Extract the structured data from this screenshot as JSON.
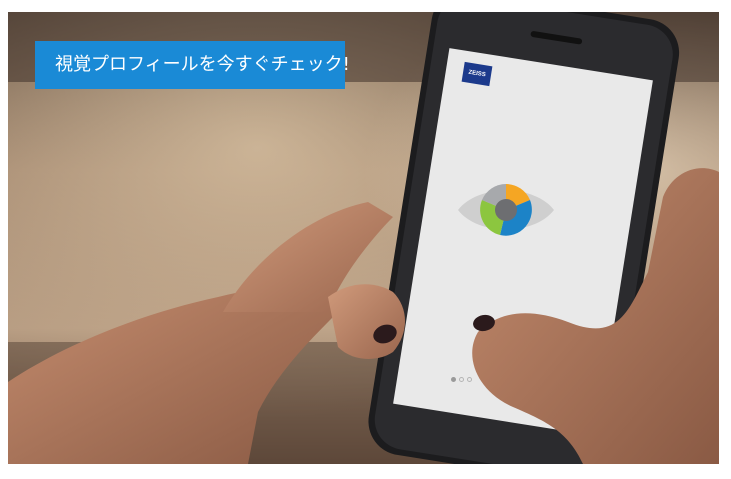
{
  "banner": {
    "text": "視覚プロフィールを今すぐチェック!",
    "color": "#1a8ad6"
  },
  "phone_screen": {
    "logo_text": "ZEISS",
    "logo_color": "#1c3a8c",
    "icon": "eye-icon",
    "pagination": {
      "pages": 3,
      "active": 1
    }
  },
  "eye_icon": {
    "segment_colors": [
      "#1c83c7",
      "#8cc63f",
      "#f5a623",
      "#6d6e71"
    ]
  }
}
